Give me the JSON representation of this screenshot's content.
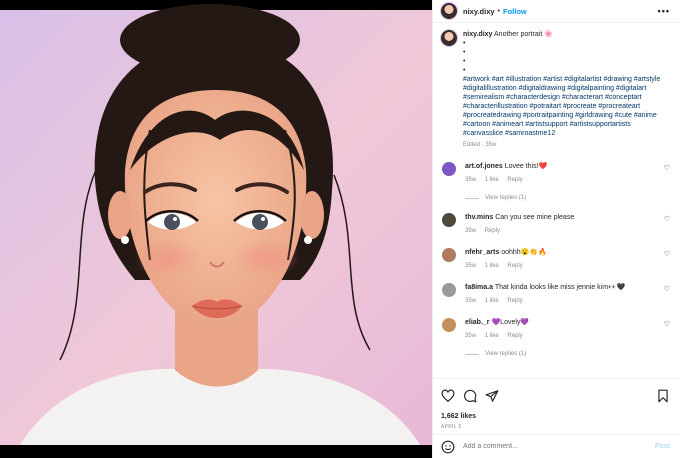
{
  "header": {
    "username": "nixy.dixy",
    "separator": "•",
    "follow_label": "Follow",
    "more_label": "•••"
  },
  "caption": {
    "username": "nixy.dixy",
    "text": "Another portrait 🌸",
    "bullets": [
      "•",
      "•",
      "•",
      "•"
    ],
    "hashtags": "#artwork #art #illustration #artist #digitalartist #drawing #artstyle #digitalillustration #digitaldrawing #digitalpainting #digitalart #semirealism #characterdesign #characterart #conceptart #characterillustration #potraitart #procreate #procreateart #procreatedrawing #portraitpainting #girldrawing #cute #anime #cartoon #animeart #artistsupport #artistsupportartists #canvasslice #samroastme12",
    "edited": "Edited · 35w"
  },
  "comments": [
    {
      "username": "art.of.jones",
      "text": "Lovee this!❤️",
      "time": "35w",
      "likes": "1 like",
      "reply": "Reply",
      "view_replies": "View replies (1)",
      "avatar_color": "#7e57c2"
    },
    {
      "username": "thv.mins",
      "text": "Can you see mine please",
      "time": "35w",
      "likes": "",
      "reply": "Reply",
      "view_replies": "",
      "avatar_color": "#4e4a3a"
    },
    {
      "username": "nfehr_arts",
      "text": "oohhh😮👏🔥",
      "time": "35w",
      "likes": "1 like",
      "reply": "Reply",
      "view_replies": "",
      "avatar_color": "#b07a62"
    },
    {
      "username": "fa8ima.a",
      "text": "That kinda looks like miss jennie kim👀🖤",
      "time": "35w",
      "likes": "1 like",
      "reply": "Reply",
      "view_replies": "",
      "avatar_color": "#9a9a9a"
    },
    {
      "username": "eliab._r",
      "text": "💜Lovely💜",
      "time": "35w",
      "likes": "1 like",
      "reply": "Reply",
      "view_replies": "View replies (1)",
      "avatar_color": "#c4915e"
    }
  ],
  "footer": {
    "likes": "1,662 likes",
    "date": "APRIL 5",
    "comment_placeholder": "Add a comment...",
    "post_label": "Post"
  },
  "icons": [
    "heart-icon",
    "comment-icon",
    "share-icon",
    "bookmark-icon",
    "emoji-icon",
    "more-icon"
  ],
  "colors": {
    "follow": "#0095f6",
    "post_disabled": "#b2dffc",
    "meta": "#8e8e8e",
    "hashtag": "#00376b"
  }
}
